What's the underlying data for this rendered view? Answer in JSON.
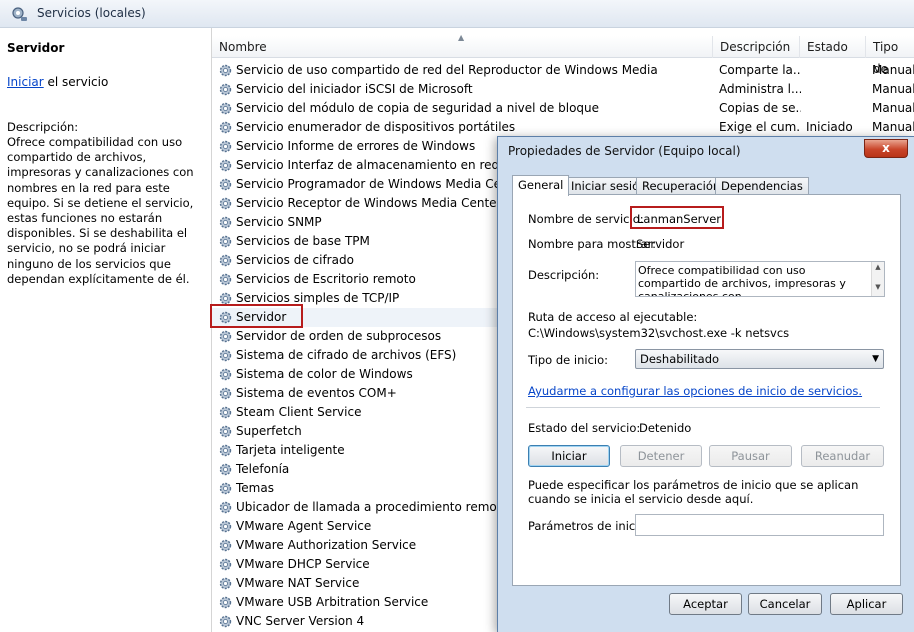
{
  "window": {
    "title": "Servicios (locales)"
  },
  "left_pane": {
    "service_name": "Servidor",
    "start_link": "Iniciar",
    "start_suffix": " el servicio",
    "description_label": "Descripción:",
    "description": "Ofrece compatibilidad con uso compartido de archivos, impresoras y canalizaciones con nombres en la red para este equipo. Si se detiene el servicio, estas funciones no estarán disponibles. Si se deshabilita el servicio, no se podrá iniciar ninguno de los servicios que dependan explícitamente de él."
  },
  "list": {
    "columns": {
      "name": "Nombre",
      "description": "Descripción",
      "status": "Estado",
      "startup": "Tipo de"
    },
    "rows": [
      {
        "name": "Servicio de uso compartido de red del Reproductor de Windows Media",
        "description": "Comparte la...",
        "status": "",
        "startup": "Manual"
      },
      {
        "name": "Servicio del iniciador iSCSI de Microsoft",
        "description": "Administra l...",
        "status": "",
        "startup": "Manual"
      },
      {
        "name": "Servicio del módulo de copia de seguridad a nivel de bloque",
        "description": "Copias de se...",
        "status": "",
        "startup": "Manual"
      },
      {
        "name": "Servicio enumerador de dispositivos portátiles",
        "description": "Exige el cum...",
        "status": "Iniciado",
        "startup": "Manual"
      },
      {
        "name": "Servicio Informe de errores de Windows",
        "description": "",
        "status": "",
        "startup": ""
      },
      {
        "name": "Servicio Interfaz de almacenamiento en red",
        "description": "",
        "status": "",
        "startup": ""
      },
      {
        "name": "Servicio Programador de Windows Media Center",
        "description": "",
        "status": "",
        "startup": ""
      },
      {
        "name": "Servicio Receptor de Windows Media Center",
        "description": "",
        "status": "",
        "startup": ""
      },
      {
        "name": "Servicio SNMP",
        "description": "",
        "status": "",
        "startup": ""
      },
      {
        "name": "Servicios de base TPM",
        "description": "",
        "status": "",
        "startup": ""
      },
      {
        "name": "Servicios de cifrado",
        "description": "",
        "status": "",
        "startup": ""
      },
      {
        "name": "Servicios de Escritorio remoto",
        "description": "",
        "status": "",
        "startup": ""
      },
      {
        "name": "Servicios simples de TCP/IP",
        "description": "",
        "status": "",
        "startup": ""
      },
      {
        "name": "Servidor",
        "description": "",
        "status": "",
        "startup": ""
      },
      {
        "name": "Servidor de orden de subprocesos",
        "description": "",
        "status": "",
        "startup": ""
      },
      {
        "name": "Sistema de cifrado de archivos (EFS)",
        "description": "",
        "status": "",
        "startup": ""
      },
      {
        "name": "Sistema de color de Windows",
        "description": "",
        "status": "",
        "startup": ""
      },
      {
        "name": "Sistema de eventos COM+",
        "description": "",
        "status": "",
        "startup": ""
      },
      {
        "name": "Steam Client Service",
        "description": "",
        "status": "",
        "startup": ""
      },
      {
        "name": "Superfetch",
        "description": "",
        "status": "",
        "startup": ""
      },
      {
        "name": "Tarjeta inteligente",
        "description": "",
        "status": "",
        "startup": ""
      },
      {
        "name": "Telefonía",
        "description": "",
        "status": "",
        "startup": ""
      },
      {
        "name": "Temas",
        "description": "",
        "status": "",
        "startup": ""
      },
      {
        "name": "Ubicador de llamada a procedimiento remoto (RP",
        "description": "",
        "status": "",
        "startup": ""
      },
      {
        "name": "VMware Agent Service",
        "description": "",
        "status": "",
        "startup": ""
      },
      {
        "name": "VMware Authorization Service",
        "description": "",
        "status": "",
        "startup": ""
      },
      {
        "name": "VMware DHCP Service",
        "description": "",
        "status": "",
        "startup": ""
      },
      {
        "name": "VMware NAT Service",
        "description": "",
        "status": "",
        "startup": ""
      },
      {
        "name": "VMware USB Arbitration Service",
        "description": "",
        "status": "",
        "startup": ""
      },
      {
        "name": "VNC Server Version 4",
        "description": "",
        "status": "",
        "startup": ""
      }
    ]
  },
  "dialog": {
    "title": "Propiedades de Servidor (Equipo local)",
    "close": "x",
    "tabs": [
      "General",
      "Iniciar sesión",
      "Recuperación",
      "Dependencias"
    ],
    "service_name_label": "Nombre de servicio:",
    "service_name": "LanmanServer",
    "display_name_label": "Nombre para mostrar:",
    "display_name": "Servidor",
    "description_label": "Descripción:",
    "description": "Ofrece compatibilidad con uso compartido de archivos, impresoras y canalizaciones con",
    "path_label": "Ruta de acceso al ejecutable:",
    "path": "C:\\Windows\\system32\\svchost.exe -k netsvcs",
    "startup_label": "Tipo de inicio:",
    "startup_value": "Deshabilitado",
    "help_link": "Ayudarme a configurar las opciones de inicio de servicios.",
    "status_label": "Estado del servicio:",
    "status_value": "Detenido",
    "buttons": {
      "start": "Iniciar",
      "stop": "Detener",
      "pause": "Pausar",
      "resume": "Reanudar"
    },
    "params_note": "Puede especificar los parámetros de inicio que se aplican cuando se inicia el servicio desde aquí.",
    "params_label": "Parámetros de inicio:",
    "params_value": "",
    "footer": {
      "ok": "Aceptar",
      "cancel": "Cancelar",
      "apply": "Aplicar"
    }
  },
  "colors": {
    "highlight": "#b71c1c",
    "link": "#0645c9",
    "dialog_bg": "#cfdeef"
  }
}
